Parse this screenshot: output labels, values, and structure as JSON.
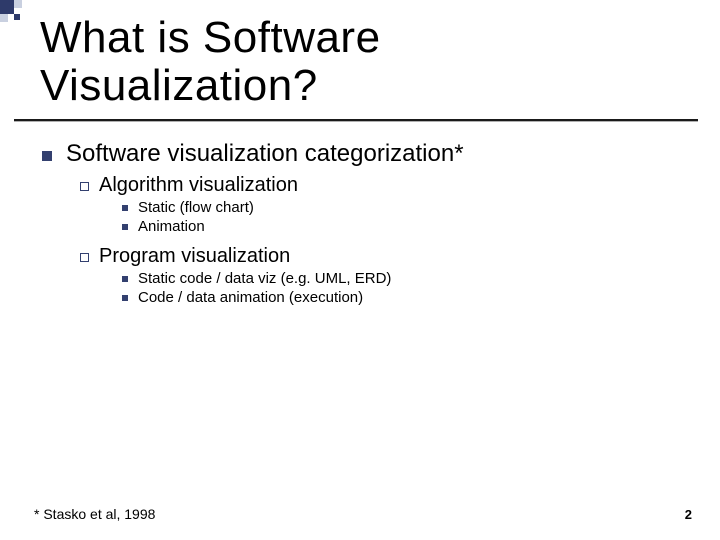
{
  "title_line1": "What is Software",
  "title_line2": "Visualization?",
  "main_point": "Software visualization categorization*",
  "sections": [
    {
      "heading": "Algorithm visualization",
      "items": [
        "Static (flow chart)",
        "Animation"
      ]
    },
    {
      "heading": "Program visualization",
      "items": [
        "Static code / data viz (e.g. UML, ERD)",
        "Code / data animation (execution)"
      ]
    }
  ],
  "footnote": "* Stasko et al, 1998",
  "page_number": "2"
}
